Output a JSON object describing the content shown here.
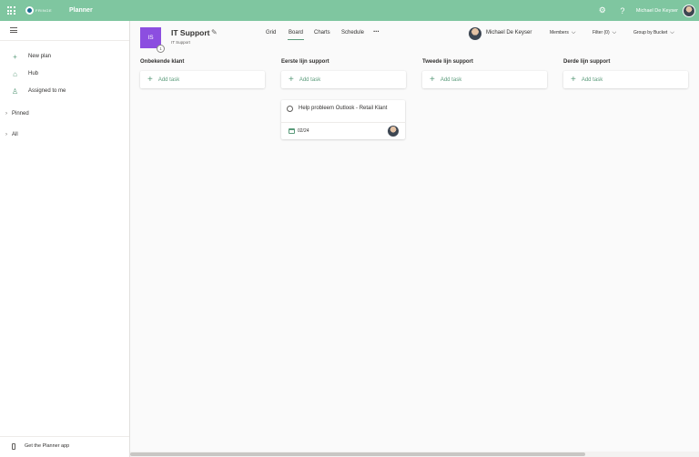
{
  "topbar": {
    "app_name": "Planner",
    "logo_text": "FRINGE",
    "settings_icon": "⚙",
    "help_icon": "?",
    "user_name": "Michael De Keyser",
    "accent": "#7fc6a0"
  },
  "sidebar": {
    "items": [
      {
        "label": "New plan",
        "icon": "plus-icon"
      },
      {
        "label": "Hub",
        "icon": "home-icon"
      },
      {
        "label": "Assigned to me",
        "icon": "person-icon"
      }
    ],
    "groups": [
      {
        "label": "Pinned"
      },
      {
        "label": "All"
      }
    ],
    "get_app": "Get the Planner app"
  },
  "plan": {
    "tile_initials": "IS",
    "tile_badge": "1",
    "title": "IT Support",
    "group": "IT Support",
    "tabs": [
      "Grid",
      "Board",
      "Charts",
      "Schedule"
    ],
    "active_tab": "Board",
    "more": "···",
    "owner_name": "Michael De Keyser",
    "members": "Members",
    "filter": "Filter (0)",
    "group_by": "Group by Bucket"
  },
  "buckets": [
    {
      "name": "Onbekende klant",
      "add_label": "Add task"
    },
    {
      "name": "Eerste lijn support",
      "add_label": "Add task"
    },
    {
      "name": "Tweede lijn support",
      "add_label": "Add task"
    },
    {
      "name": "Derde lijn support",
      "add_label": "Add task"
    }
  ],
  "tasks": [
    {
      "bucket": "Eerste lijn support",
      "title": "Help probleem Outlook - Retail Klant",
      "due": "02/24"
    }
  ],
  "colors": {
    "plan_tile": "#8c4ee0",
    "green_accent": "#5b9b7b"
  }
}
